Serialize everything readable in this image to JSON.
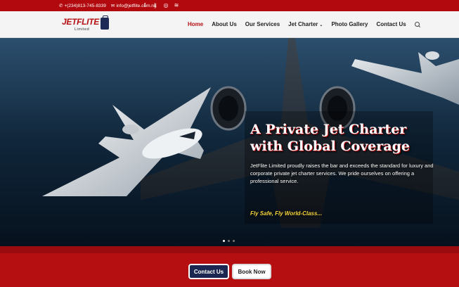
{
  "topbar": {
    "phone": "+(234)813-745-8339",
    "email": "info@jetflite.com.ng",
    "social_icons": [
      "facebook-icon",
      "twitter-icon",
      "instagram-icon",
      "rss-icon"
    ]
  },
  "logo": {
    "word": "JETFLITE",
    "sub": "Limited"
  },
  "nav": {
    "items": [
      "Home",
      "About Us",
      "Our Services",
      "Jet Charter",
      "Photo Gallery",
      "Contact Us"
    ],
    "active": "Home"
  },
  "hero": {
    "headline": "A Private Jet Charter with Global Coverage",
    "blurb": "JetFlite Limited proudly raises the bar and exceeds the standard for luxury and corporate private jet charter services. We pride ourselves on offering a professional service.",
    "slogan": "Fly Safe, Fly World-Class..."
  },
  "cta": {
    "contact": "Contact Us",
    "book": "Book Now"
  },
  "colors": {
    "brand_red": "#b50f12",
    "navy": "#1b2750",
    "slogan_yellow": "#f7d63d"
  }
}
